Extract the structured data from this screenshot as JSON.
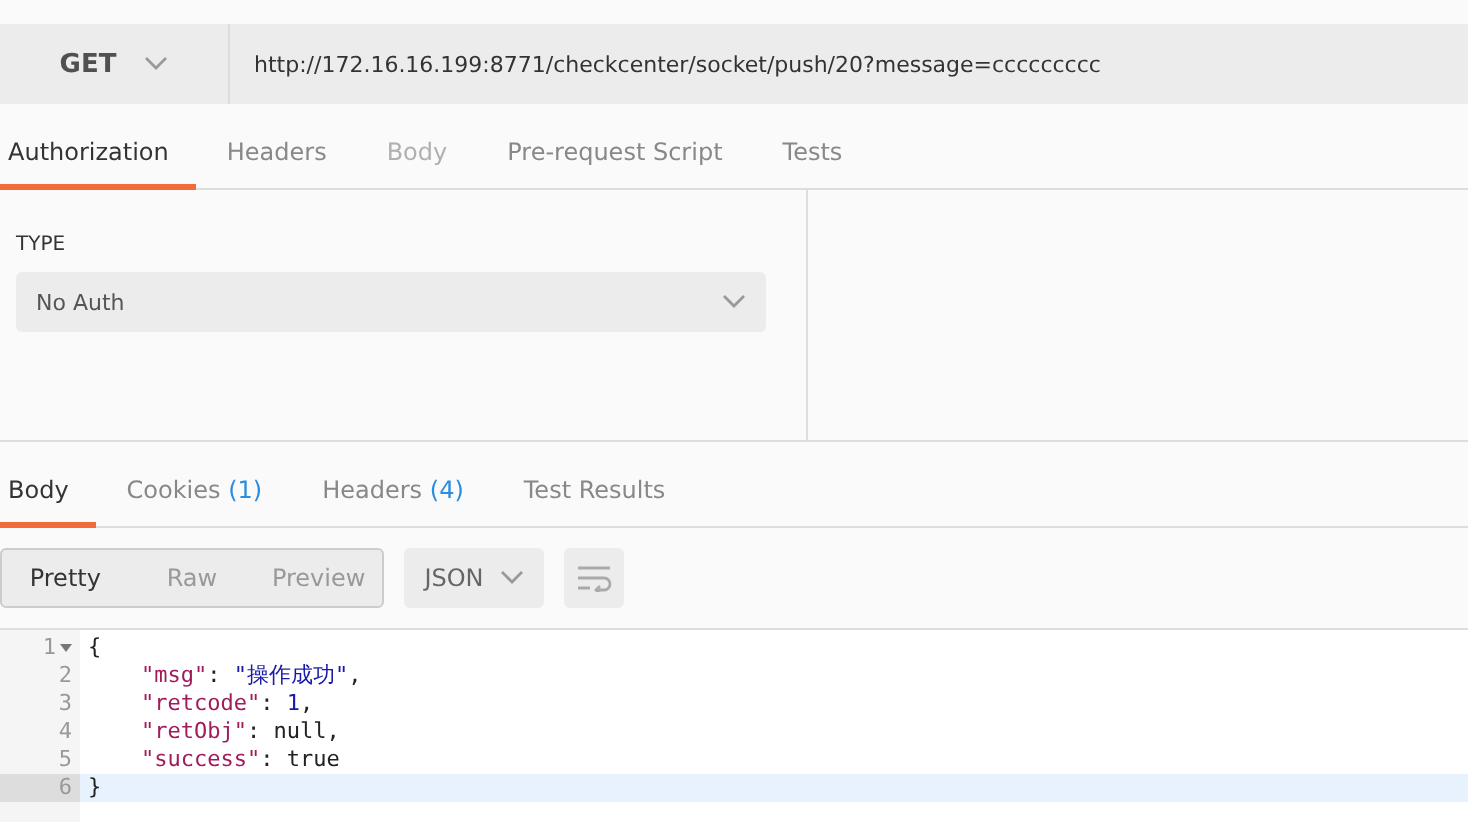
{
  "request": {
    "method": "GET",
    "url": "http://172.16.16.199:8771/checkcenter/socket/push/20?message=ccccccccc"
  },
  "request_tabs": [
    {
      "label": "Authorization",
      "selected": true,
      "disabled": false
    },
    {
      "label": "Headers",
      "selected": false,
      "disabled": false
    },
    {
      "label": "Body",
      "selected": false,
      "disabled": true
    },
    {
      "label": "Pre-request Script",
      "selected": false,
      "disabled": false
    },
    {
      "label": "Tests",
      "selected": false,
      "disabled": false
    }
  ],
  "auth": {
    "label": "TYPE",
    "value": "No Auth"
  },
  "response_tabs": [
    {
      "label": "Body",
      "selected": true
    },
    {
      "label": "Cookies",
      "count": "(1)",
      "selected": false
    },
    {
      "label": "Headers",
      "count": "(4)",
      "selected": false
    },
    {
      "label": "Test Results",
      "selected": false
    }
  ],
  "view_modes": [
    {
      "label": "Pretty",
      "selected": true
    },
    {
      "label": "Raw",
      "selected": false
    },
    {
      "label": "Preview",
      "selected": false
    }
  ],
  "format": "JSON",
  "code_lines": [
    {
      "number": "1",
      "foldable": true,
      "active": false,
      "tokens": [
        {
          "kind": "punct",
          "text": "{"
        }
      ]
    },
    {
      "number": "2",
      "foldable": false,
      "active": false,
      "tokens": [
        {
          "kind": "key",
          "text": "\"msg\""
        },
        {
          "kind": "punct",
          "text": ": "
        },
        {
          "kind": "string",
          "text": "\"操作成功\""
        },
        {
          "kind": "punct",
          "text": ","
        }
      ]
    },
    {
      "number": "3",
      "foldable": false,
      "active": false,
      "tokens": [
        {
          "kind": "key",
          "text": "\"retcode\""
        },
        {
          "kind": "punct",
          "text": ": "
        },
        {
          "kind": "number",
          "text": "1"
        },
        {
          "kind": "punct",
          "text": ","
        }
      ]
    },
    {
      "number": "4",
      "foldable": false,
      "active": false,
      "tokens": [
        {
          "kind": "key",
          "text": "\"retObj\""
        },
        {
          "kind": "punct",
          "text": ": "
        },
        {
          "kind": "punct",
          "text": "null,"
        }
      ]
    },
    {
      "number": "5",
      "foldable": false,
      "active": false,
      "tokens": [
        {
          "kind": "key",
          "text": "\"success\""
        },
        {
          "kind": "punct",
          "text": ": "
        },
        {
          "kind": "punct",
          "text": "true"
        }
      ]
    },
    {
      "number": "6",
      "foldable": false,
      "active": true,
      "tokens": [
        {
          "kind": "punct",
          "text": "}"
        }
      ]
    }
  ]
}
